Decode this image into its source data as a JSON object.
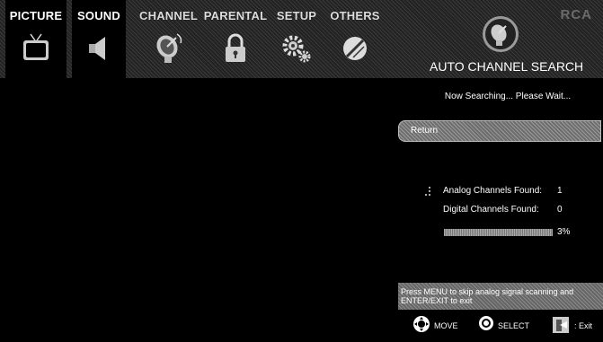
{
  "menu": {
    "tabs": [
      {
        "label": "PICTURE",
        "icon": "tv-icon"
      },
      {
        "label": "SOUND",
        "icon": "speaker-icon"
      },
      {
        "label": "CHANNEL",
        "icon": "satellite-dish-icon"
      },
      {
        "label": "PARENTAL",
        "icon": "lock-icon"
      },
      {
        "label": "SETUP",
        "icon": "gears-icon"
      },
      {
        "label": "OTHERS",
        "icon": "others-icon"
      }
    ],
    "brand": "RCA"
  },
  "header": {
    "title": "AUTO CHANNEL SEARCH",
    "icon": "satellite-dish-icon"
  },
  "panel": {
    "status": "Now Searching... Please Wait...",
    "return_label": "Return",
    "analog_label": "Analog Channels Found:",
    "analog_count": "1",
    "digital_label": "Digital Channels Found:",
    "digital_count": "0",
    "progress_text": "3%",
    "progress": 0.03,
    "help_text": "Press MENU to skip analog signal scanning and ENTER/EXIT to exit"
  },
  "legend": {
    "move": "MOVE",
    "select": "SELECT",
    "exit": ": Exit"
  },
  "colors": {
    "background": "#000000",
    "menubar": "#2b2b2b",
    "text": "#ffffff"
  }
}
